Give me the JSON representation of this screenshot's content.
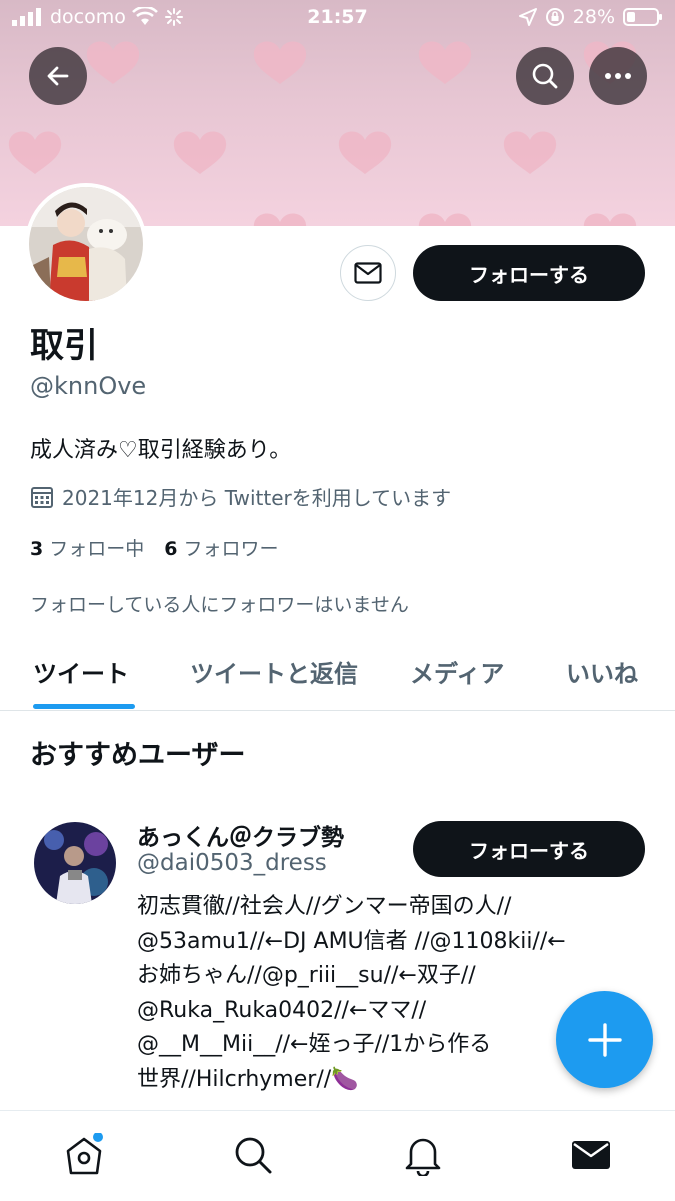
{
  "status_bar": {
    "carrier": "docomo",
    "time": "21:57",
    "battery": "28%"
  },
  "header": {
    "back_icon": "arrow-left-icon",
    "search_icon": "search-icon",
    "more_icon": "more-dots-icon",
    "banner_colors": [
      "#d8b9c6",
      "#f4d2df",
      "#f1bfcf"
    ]
  },
  "profile": {
    "name": "取引",
    "handle": "@knnOve",
    "bio": "成人済み♡取引経験あり。",
    "joined": "2021年12月から Twitterを利用しています",
    "following_count": "3",
    "following_label": "フォロー中",
    "followers_count": "6",
    "followers_label": "フォロワー",
    "no_mutual": "フォローしている人にフォロワーはいません",
    "follow_button": "フォローする"
  },
  "tabs": [
    {
      "label": "ツイート",
      "active": true
    },
    {
      "label": "ツイートと返信",
      "active": false
    },
    {
      "label": "メディア",
      "active": false
    },
    {
      "label": "いいね",
      "active": false
    }
  ],
  "recommendations": {
    "title": "おすすめユーザー",
    "user": {
      "name": "あっくん＠クラブ勢",
      "handle": "@dai0503_dress",
      "follow_button": "フォローする",
      "bio_lines": [
        "初志貫徹//社会人//グンマー帝国の人//",
        "@53amu1//←DJ AMU信者 //@1108kii//←",
        "お姉ちゃん//@p_riii__su//←双子//",
        "@Ruka_Ruka0402//←ママ//",
        "@__M__Mii__//←姪っ子//1から作る",
        "世界//Hilcrhymer//🍆"
      ]
    }
  },
  "bottom_nav": [
    "home-icon",
    "search-icon",
    "notifications-icon",
    "messages-icon"
  ],
  "colors": {
    "accent": "#1d9bf0",
    "button_dark": "#0f1419",
    "secondary_text": "#536471"
  }
}
